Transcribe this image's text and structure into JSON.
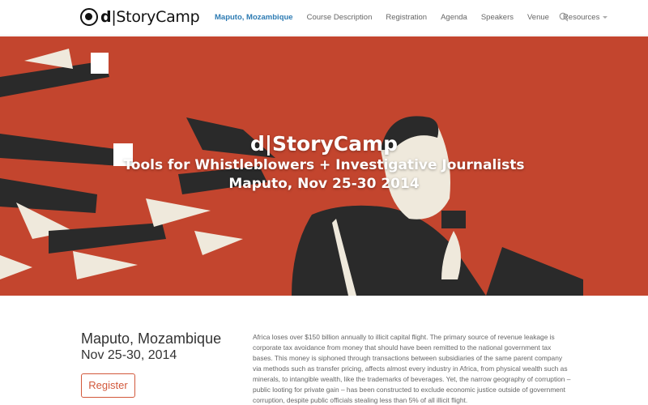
{
  "header": {
    "logo": {
      "prefix": "d",
      "name": "|StoryCamp"
    },
    "nav": [
      {
        "label": "Maputo, Mozambique",
        "active": true
      },
      {
        "label": "Course Description"
      },
      {
        "label": "Registration"
      },
      {
        "label": "Agenda"
      },
      {
        "label": "Speakers"
      },
      {
        "label": "Venue"
      },
      {
        "label": "Resources",
        "has_dropdown": true
      }
    ],
    "search_icon": "search-icon"
  },
  "hero": {
    "title": "d|StoryCamp",
    "subtitle": "Tools for Whistleblowers + Investigative Journalists",
    "location_dates": "Maputo, Nov 25-30 2014",
    "background_color": "#c3452e"
  },
  "event": {
    "city": "Maputo, Mozambique",
    "dates": "Nov 25-30, 2014",
    "register_label": "Register",
    "accent_color": "#d2583b"
  },
  "intro_text": "Africa loses over $150 billion annually to illicit capital flight. The primary source of revenue leakage is corporate tax avoidance from money that should have been remitted to the national government tax bases. This money is siphoned through transactions between subsidiaries of the same parent company via methods such as transfer pricing, affects almost every industry in Africa, from physical wealth such as minerals, to intangible wealth, like the trademarks of beverages. Yet, the narrow geography of corruption – public looting for private gain – has been constructed to exclude economic justice outside of government corruption, despite public officials stealing less than 5% of all illicit flight."
}
